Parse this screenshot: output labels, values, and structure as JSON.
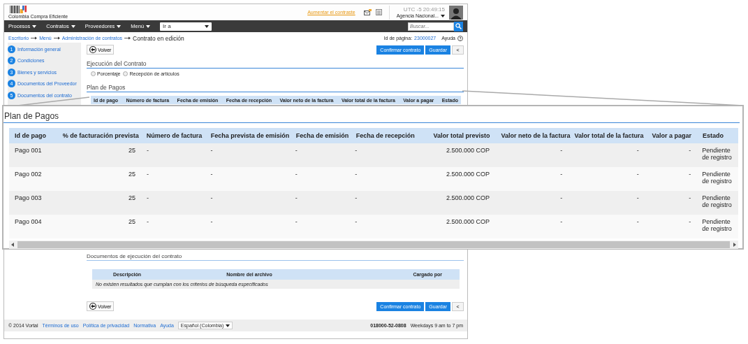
{
  "header": {
    "logo_text": "Colombia Compra Eficiente",
    "contrast_link": "Aumentar el contraste",
    "time": "UTC -5 20:49:15",
    "account": "Agencia Nacional..."
  },
  "nav": {
    "menus": [
      "Procesos",
      "Contratos",
      "Proveedores",
      "Menú"
    ],
    "goto": "Ir a",
    "search_placeholder": "Buscar..."
  },
  "breadcrumb": {
    "links": [
      "Escritorio",
      "Menú",
      "Administración de contratos"
    ],
    "current": "Contrato en edición",
    "page_id_label": "Id de página:",
    "page_id": "23000027",
    "help": "Ayuda"
  },
  "sidebar": {
    "steps": [
      {
        "number": "1",
        "label": "Información general"
      },
      {
        "number": "2",
        "label": "Condiciones"
      },
      {
        "number": "3",
        "label": "Bienes y servicios"
      },
      {
        "number": "4",
        "label": "Documentos del Proveedor"
      },
      {
        "number": "5",
        "label": "Documentos del contrato"
      }
    ]
  },
  "actions": {
    "back": "Volver",
    "confirm": "Confirmar contrato",
    "save": "Guardar",
    "collapse": "<"
  },
  "execution": {
    "title": "Ejecución del Contrato",
    "options": [
      {
        "label": "Porcentaje",
        "selected": false
      },
      {
        "label": "Recepción de artículos",
        "selected": false
      }
    ]
  },
  "plan": {
    "title": "Plan de Pagos",
    "columns": [
      "Id de pago",
      "Número de factura",
      "Fecha de emisión",
      "Fecha de recepción",
      "Valor neto de la factura",
      "Valor total de la factura",
      "Valor a pagar",
      "Estado"
    ]
  },
  "callout": {
    "title": "Plan de Pagos",
    "columns": [
      {
        "label": "Id de pago",
        "kind": "text"
      },
      {
        "label": "% de facturación prevista",
        "kind": "numeric"
      },
      {
        "label": "Número de factura",
        "kind": "text"
      },
      {
        "label": "Fecha prevista de emisión",
        "kind": "text"
      },
      {
        "label": "Fecha de emisión",
        "kind": "text"
      },
      {
        "label": "Fecha de recepción",
        "kind": "text"
      },
      {
        "label": "Valor total previsto",
        "kind": "numeric"
      },
      {
        "label": "Valor neto de la factura",
        "kind": "numeric"
      },
      {
        "label": "Valor total de la factura",
        "kind": "numeric"
      },
      {
        "label": "Valor a pagar",
        "kind": "numeric"
      },
      {
        "label": "Estado",
        "kind": "text"
      }
    ],
    "rows": [
      [
        "Pago 001",
        "25",
        "-",
        "-",
        "-",
        "-",
        "2.500.000 COP",
        "-",
        "-",
        "-",
        "Pendiente de registro"
      ],
      [
        "Pago 002",
        "25",
        "-",
        "-",
        "-",
        "-",
        "2.500.000 COP",
        "-",
        "-",
        "-",
        "Pendiente de registro"
      ],
      [
        "Pago 003",
        "25",
        "-",
        "-",
        "-",
        "-",
        "2.500.000 COP",
        "-",
        "-",
        "-",
        "Pendiente de registro"
      ],
      [
        "Pago 004",
        "25",
        "-",
        "-",
        "-",
        "-",
        "2.500.000 COP",
        "-",
        "-",
        "-",
        "Pendiente de registro"
      ]
    ]
  },
  "documents": {
    "title": "Documentos de ejecución del contrato",
    "columns": [
      "Descripción",
      "Nombre del archivo",
      "Cargado por"
    ],
    "empty_message": "No existen resultados que cumplan con los criterios de búsqueda especificados"
  },
  "bottom_actions": {
    "back": "Volver",
    "confirm": "Confirmar contrato",
    "save": "Guardar",
    "collapse": "<"
  },
  "footer": {
    "copyright": "© 2014 Vortal",
    "links": [
      "Términos de uso",
      "Política de privacidad",
      "Normativa",
      "Ayuda"
    ],
    "language": "Español (Colombia)",
    "phone": "018000-52-0808",
    "hours": "Weekdays 9 am to 7 pm"
  }
}
